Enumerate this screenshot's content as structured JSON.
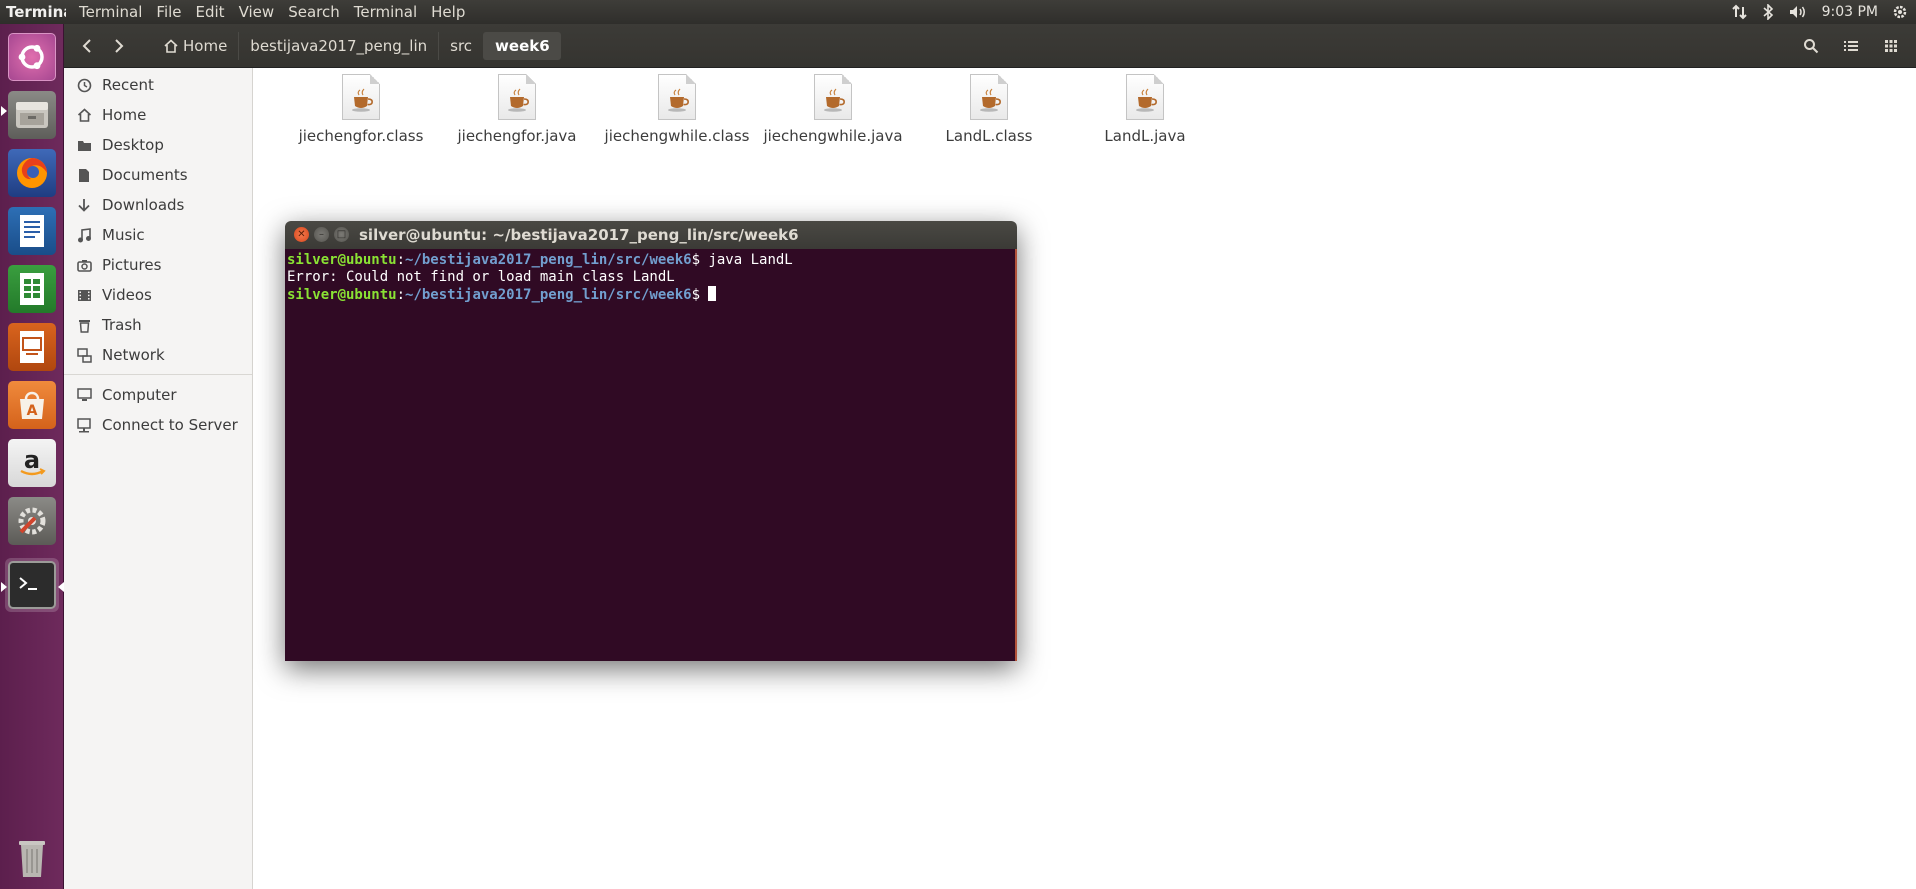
{
  "top_panel": {
    "app_name": "Terminal",
    "menus": [
      "Terminal",
      "File",
      "Edit",
      "View",
      "Search",
      "Terminal",
      "Help"
    ],
    "clock": "9:03 PM",
    "indicators": [
      "network-arrows-icon",
      "bluetooth-icon",
      "volume-icon",
      "settings-gear-icon"
    ]
  },
  "launcher": {
    "items": [
      "ubuntu-dash-icon",
      "files-icon",
      "firefox-icon",
      "libreoffice-writer-icon",
      "libreoffice-calc-icon",
      "libreoffice-impress-icon",
      "software-center-icon",
      "amazon-icon",
      "system-settings-icon",
      "terminal-icon",
      "trash-icon"
    ]
  },
  "file_manager": {
    "breadcrumbs": [
      "Home",
      "bestijava2017_peng_lin",
      "src",
      "week6"
    ],
    "active_crumb": "week6",
    "sidebar": {
      "places": [
        "Recent",
        "Home",
        "Desktop",
        "Documents",
        "Downloads",
        "Music",
        "Pictures",
        "Videos",
        "Trash",
        "Network"
      ],
      "devices": [
        "Computer",
        "Connect to Server"
      ]
    },
    "files": [
      "jiechengfor.class",
      "jiechengfor.java",
      "jiechengwhile.class",
      "jiechengwhile.java",
      "LandL.class",
      "LandL.java"
    ]
  },
  "terminal": {
    "title": "silver@ubuntu: ~/bestijava2017_peng_lin/src/week6",
    "prompt_user": "silver@ubuntu",
    "prompt_sep": ":",
    "prompt_path": "~/bestijava2017_peng_lin/src/week6",
    "prompt_suffix": "$ ",
    "lines": [
      {
        "type": "prompt",
        "command": "java LandL"
      },
      {
        "type": "output",
        "text": "Error: Could not find or load main class LandL"
      },
      {
        "type": "prompt",
        "command": ""
      }
    ]
  },
  "colors": {
    "launcher": "#5c1f4d",
    "terminal_bg": "#300a24",
    "prompt_user": "#8ae234",
    "prompt_path": "#729fcf",
    "close_button": "#e8552a"
  }
}
